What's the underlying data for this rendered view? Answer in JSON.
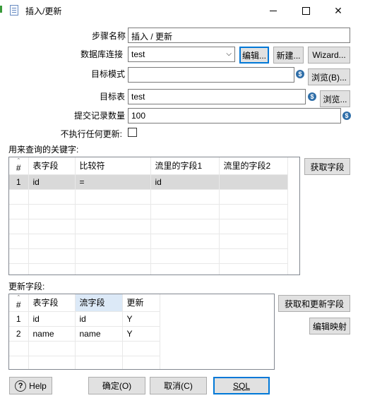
{
  "window": {
    "title": "插入/更新"
  },
  "form": {
    "step_name_label": "步骤名称",
    "step_name_value": "插入 / 更新",
    "db_conn_label": "数据库连接",
    "db_conn_value": "test",
    "edit_btn": "编辑...",
    "new_btn": "新建...",
    "wizard_btn": "Wizard...",
    "target_schema_label": "目标模式",
    "target_schema_value": "",
    "browse_btn_1": "浏览(B)...",
    "target_table_label": "目标表",
    "target_table_value": "test",
    "browse_btn_2": "浏览...",
    "commit_size_label": "提交记录数量",
    "commit_size_value": "100",
    "no_update_label": "不执行任何更新:",
    "no_update_checked": false,
    "var_icon": "$"
  },
  "keys": {
    "section_label": "用来查询的关键字:",
    "get_fields_btn": "获取字段",
    "columns": [
      "#",
      "表字段",
      "比较符",
      "流里的字段1",
      "流里的字段2"
    ],
    "rows": [
      {
        "num": "1",
        "table_field": "id",
        "comparator": "=",
        "stream_field1": "id",
        "stream_field2": ""
      }
    ]
  },
  "update": {
    "section_label": "更新字段:",
    "get_update_fields_btn": "获取和更新字段",
    "edit_mapping_btn": "编辑映射",
    "columns": [
      "#",
      "表字段",
      "流字段",
      "更新"
    ],
    "rows": [
      {
        "num": "1",
        "table_field": "id",
        "stream_field": "id",
        "update": "Y"
      },
      {
        "num": "2",
        "table_field": "name",
        "stream_field": "name",
        "update": "Y"
      }
    ]
  },
  "footer": {
    "help_btn": "Help",
    "ok_btn": "确定(O)",
    "cancel_btn": "取消(C)",
    "sql_btn": "SQL"
  }
}
